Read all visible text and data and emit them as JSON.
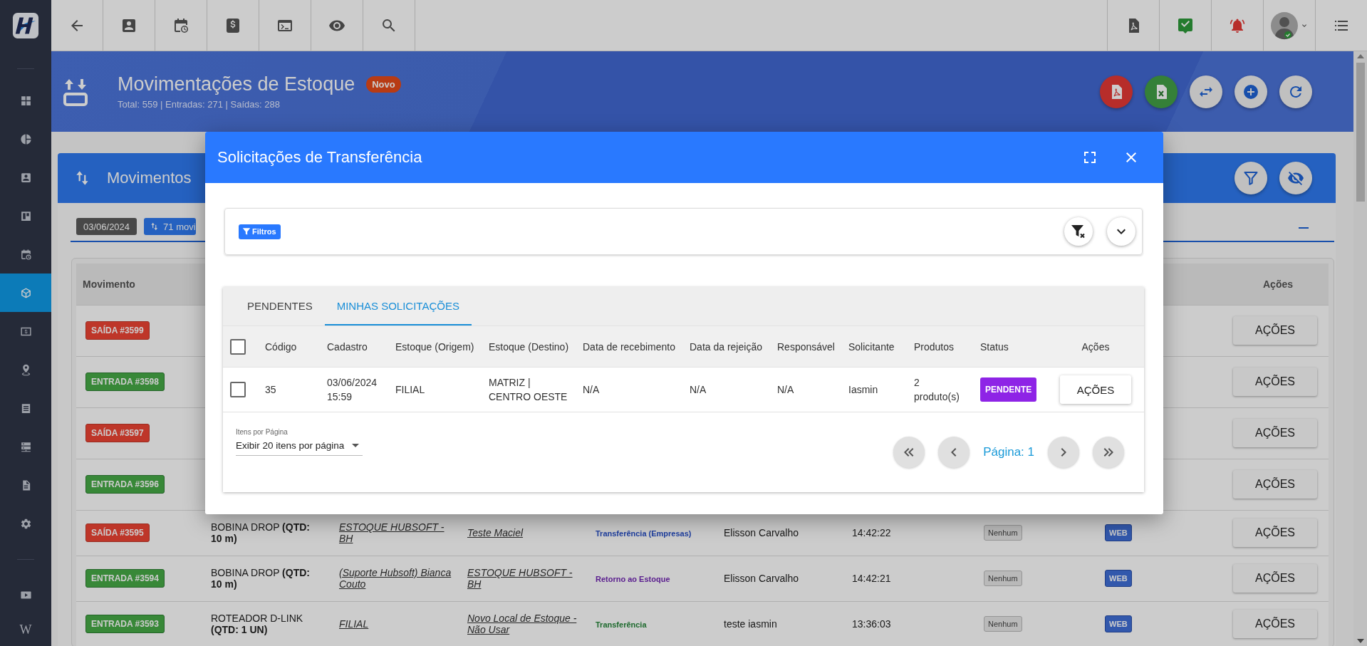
{
  "sidebar": {
    "items": [
      {
        "kind": "icon",
        "selected": false
      },
      {
        "kind": "icon",
        "selected": false
      },
      {
        "kind": "icon",
        "selected": false
      },
      {
        "kind": "icon",
        "selected": false
      },
      {
        "kind": "icon",
        "selected": false
      },
      {
        "kind": "icon",
        "selected": true
      },
      {
        "kind": "icon",
        "selected": false
      },
      {
        "kind": "icon",
        "selected": false
      },
      {
        "kind": "icon",
        "selected": false
      },
      {
        "kind": "icon",
        "selected": false
      },
      {
        "kind": "icon",
        "selected": false
      },
      {
        "kind": "icon",
        "selected": false
      },
      {
        "kind": "icon",
        "selected": false
      },
      {
        "kind": "text",
        "label": "W",
        "selected": false
      }
    ]
  },
  "header": {
    "title": "Movimentações de Estoque",
    "badge": "Novo",
    "subtitle": "Total: 559 | Entradas: 271 | Saídas: 288"
  },
  "card": {
    "title": "Movimentos",
    "chips": [
      {
        "kind": "date",
        "label": "03/06/2024"
      },
      {
        "kind": "count",
        "label": "71 movi"
      }
    ],
    "table": {
      "columns": [
        "Movimento",
        "Ações"
      ],
      "rows": [
        {
          "kind": "exit",
          "badge": "SAÍDA #3599",
          "action": "AÇÕES"
        },
        {
          "kind": "entry",
          "badge": "ENTRADA #3598",
          "action": "AÇÕES"
        },
        {
          "kind": "exit",
          "badge": "SAÍDA #3597",
          "action": "AÇÕES"
        },
        {
          "kind": "entry",
          "badge": "ENTRADA #3596",
          "action": "AÇÕES"
        },
        {
          "kind": "exit",
          "badge": "SAÍDA #3595",
          "product": "BOBINA DROP **(QTD: 10 m)**",
          "origin": "ESTOQUE HUBSOFT - BH",
          "destination": "Teste Maciel",
          "type": {
            "label": "Transferência (Empresas)",
            "kind": "company_transfer"
          },
          "user": "Elisson Carvalho",
          "time": "14:42:22",
          "tag": "Nenhum",
          "channel": "WEB",
          "action": "AÇÕES"
        },
        {
          "kind": "entry",
          "badge": "ENTRADA #3594",
          "product": "BOBINA DROP **(QTD: 10 m)**",
          "origin": "(Suporte Hubsoft) Bianca Couto",
          "destination": "ESTOQUE HUBSOFT - BH",
          "type": {
            "label": "Retorno ao Estoque",
            "kind": "return"
          },
          "user": "Elisson Carvalho",
          "time": "14:42:21",
          "tag": "Nenhum",
          "channel": "WEB",
          "action": "AÇÕES"
        },
        {
          "kind": "entry",
          "badge": "ENTRADA #3593",
          "product": "ROTEADOR D-LINK **(QTD: 1 UN)**",
          "origin": "FILIAL",
          "destination": "Novo Local de Estoque - Não Usar",
          "type": {
            "label": "Transferência",
            "kind": "transfer"
          },
          "user": "teste iasmin",
          "time": "13:36:03",
          "tag": "Nenhum",
          "channel": "WEB",
          "action": "AÇÕES"
        }
      ]
    }
  },
  "modal": {
    "title": "Solicitações de Transferência",
    "filters": {
      "label": "Filtros"
    },
    "tabs": [
      {
        "label": "PENDENTES",
        "selected": false
      },
      {
        "label": "MINHAS SOLICITAÇÕES",
        "selected": true
      }
    ],
    "table": {
      "all_checked": false,
      "columns": [
        "Código",
        "Cadastro",
        "Estoque (Origem)",
        "Estoque (Destino)",
        "Data de recebimento",
        "Data da rejeição",
        "Responsável",
        "Solicitante",
        "Produtos",
        "Status",
        "Ações"
      ],
      "rows": [
        {
          "checked": false,
          "cells": [
            "35",
            "03/06/2024 15:59",
            "FILIAL",
            "MATRIZ | CENTRO OESTE",
            "N/A",
            "N/A",
            "N/A",
            "Iasmin",
            "2 produto(s)"
          ],
          "status": {
            "label": "PENDENTE",
            "color": "#8e24e6"
          },
          "action": "AÇÕES"
        }
      ]
    },
    "page_size": {
      "label": "Itens por Página",
      "value": "Exibir 20 itens por página"
    },
    "pagination": {
      "label": "Página: 1"
    }
  }
}
